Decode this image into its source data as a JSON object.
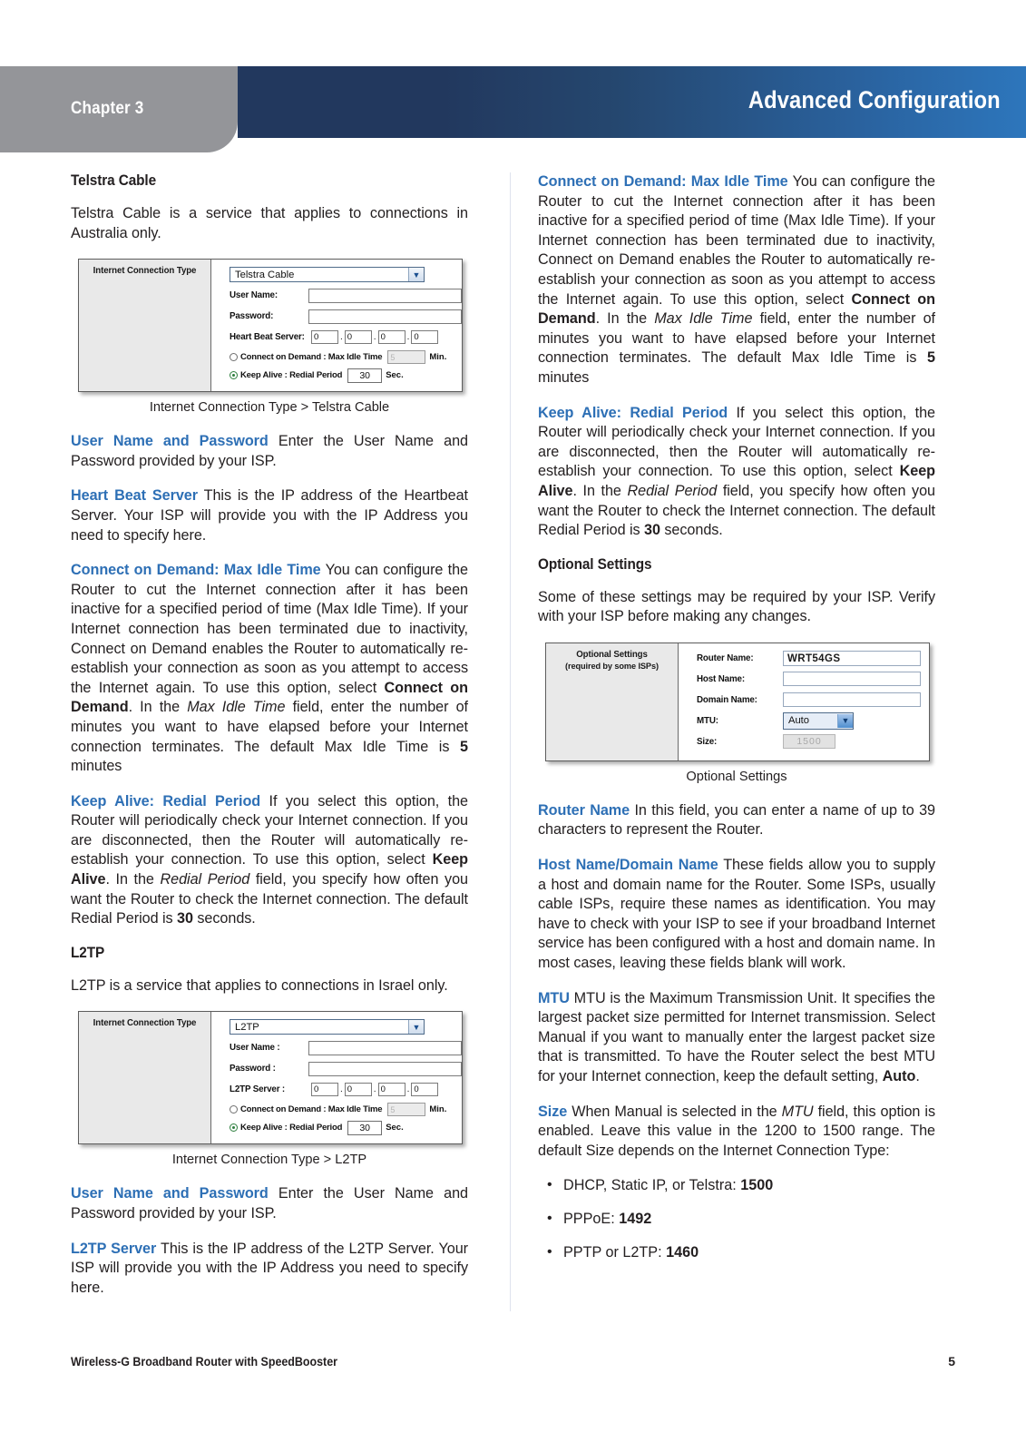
{
  "header": {
    "chapter": "Chapter 3",
    "title": "Advanced Configuration",
    "tab_color": "#949599",
    "bar_color_left": "#22385e",
    "bar_color_right": "#2d76bc"
  },
  "accent_color": "#2d6fb5",
  "left_column": {
    "telstra_heading": "Telstra Cable",
    "telstra_intro": "Telstra Cable is a service that applies to connections in Australia only.",
    "telstra_figure": {
      "panel_title": "Internet Connection Type",
      "select_value": "Telstra Cable",
      "rows": [
        {
          "label": "User Name:",
          "value": ""
        },
        {
          "label": "Password:",
          "value": ""
        }
      ],
      "ip_label": "Heart Beat Server:",
      "ip_octets": [
        "0",
        "0",
        "0",
        "0"
      ],
      "connect_on_demand_label": "Connect on Demand : Max Idle Time",
      "connect_on_demand_value": "5",
      "connect_on_demand_unit": "Min.",
      "connect_on_demand_selected": false,
      "keep_alive_label": "Keep Alive : Redial Period",
      "keep_alive_value": "30",
      "keep_alive_unit": "Sec.",
      "keep_alive_selected": true,
      "caption": "Internet Connection Type > Telstra Cable"
    },
    "user_name_password_term": "User Name and Password",
    "user_name_password_text": " Enter the User Name and Password provided by your ISP.",
    "heart_beat_term": "Heart Beat Server",
    "heart_beat_text": "  This is the IP address of the  Heartbeat Server. Your ISP will provide you with the IP Address you need to specify here.",
    "cod_term": "Connect on Demand: Max Idle Time",
    "cod_text_1": "  You can configure the Router to cut the Internet connection after it has been inactive for a specified period of time (Max Idle Time). If your Internet connection has been terminated due to inactivity, Connect on Demand enables the Router to automatically re-establish your connection as soon as you attempt to access the Internet again. To use this option, select ",
    "cod_bold_1": "Connect on Demand",
    "cod_text_2": ". In the ",
    "cod_italic": "Max Idle Time",
    "cod_text_3": " field, enter the number of minutes you want to have elapsed before your Internet connection terminates. The default Max Idle Time is ",
    "cod_bold_2": "5",
    "cod_text_4": " minutes",
    "ka_term": "Keep Alive: Redial Period",
    "ka_text_1": " If you select this option, the Router will periodically check your Internet connection. If you are disconnected, then the Router will automatically re-establish your connection. To use this option, select ",
    "ka_bold_1": "Keep Alive",
    "ka_text_2": ". In the ",
    "ka_italic": "Redial Period",
    "ka_text_3": " field, you specify how often you want the Router to check the Internet connection. The default Redial Period is ",
    "ka_bold_2": "30",
    "ka_text_4": " seconds.",
    "l2tp_heading": "L2TP",
    "l2tp_intro": "L2TP is a service that applies to connections in Israel only.",
    "l2tp_figure": {
      "panel_title": "Internet Connection Type",
      "select_value": "L2TP",
      "rows": [
        {
          "label": "User Name :",
          "value": ""
        },
        {
          "label": "Password :",
          "value": ""
        }
      ],
      "ip_label": "L2TP Server :",
      "ip_octets": [
        "0",
        "0",
        "0",
        "0"
      ],
      "connect_on_demand_label": "Connect on Demand : Max Idle Time",
      "connect_on_demand_value": "5",
      "connect_on_demand_unit": "Min.",
      "connect_on_demand_selected": false,
      "keep_alive_label": "Keep Alive : Redial Period",
      "keep_alive_value": "30",
      "keep_alive_unit": "Sec.",
      "keep_alive_selected": true,
      "caption": "Internet Connection Type > L2TP"
    },
    "l2tp_unp_term": "User Name and Password",
    "l2tp_unp_text": " Enter the User Name and Password provided by your ISP.",
    "l2tp_server_term": "L2TP Server",
    "l2tp_server_text": "  This is the IP address of the L2TP Server. Your ISP will provide you with the IP Address you need to specify here."
  },
  "right_column": {
    "cod_term": "Connect on Demand: Max Idle Time",
    "cod_text_1": "  You can configure the Router to cut the Internet connection after it has been inactive for a specified period of time (Max Idle Time). If your Internet connection has been terminated due to inactivity, Connect on Demand enables the Router to automatically re-establish your connection as soon as you attempt to access the Internet again. To use this option, select ",
    "cod_bold_1": "Connect on Demand",
    "cod_text_2": ". In the ",
    "cod_italic": "Max Idle Time",
    "cod_text_3": " field, enter the number of minutes you want to have elapsed before your Internet connection terminates. The default Max Idle Time is ",
    "cod_bold_2": "5",
    "cod_text_4": " minutes",
    "ka_term": "Keep Alive: Redial Period",
    "ka_text_1": " If you select this option, the Router will periodically check your Internet connection. If you are disconnected, then the Router will automatically re-establish your connection. To use this option, select ",
    "ka_bold_1": "Keep Alive",
    "ka_text_2": ". In the ",
    "ka_italic": "Redial Period",
    "ka_text_3": " field, you specify how often you want the Router to check the Internet connection. The default Redial Period is ",
    "ka_bold_2": "30",
    "ka_text_4": " seconds.",
    "optional_heading": "Optional Settings",
    "optional_intro": "Some of these settings may be required by your ISP. Verify with your ISP before making any changes.",
    "optional_figure": {
      "panel_title_line1": "Optional Settings",
      "panel_title_line2": "(required by some ISPs)",
      "rows": [
        {
          "label": "Router Name:",
          "value": "WRT54GS"
        },
        {
          "label": "Host Name:",
          "value": ""
        },
        {
          "label": "Domain Name:",
          "value": ""
        }
      ],
      "mtu_label": "MTU:",
      "mtu_value": "Auto",
      "size_label": "Size:",
      "size_value": "1500",
      "caption": "Optional Settings"
    },
    "router_name_term": "Router Name",
    "router_name_text": "  In this field, you can enter a name of up to 39 characters to represent the Router.",
    "host_domain_term": "Host Name/Domain Name",
    "host_domain_text": " These fields allow you to supply a host and domain name for the Router. Some ISPs, usually cable ISPs, require these names as identification. You may have to check with your ISP to see if your broadband Internet service has been configured with a host and domain name. In most cases, leaving these fields blank will work.",
    "mtu_term": "MTU",
    "mtu_text_1": "  MTU is the Maximum Transmission Unit. It specifies the largest packet size permitted for Internet transmission. Select Manual if you want to manually enter the largest packet size that is transmitted. To have the Router select the best MTU for your Internet connection, keep the default setting, ",
    "mtu_bold": "Auto",
    "mtu_text_2": ".",
    "size_term": "Size",
    "size_text_1": "  When Manual is selected in the ",
    "size_italic": "MTU",
    "size_text_2": " field, this option is enabled. Leave this value in the 1200 to 1500 range. The default Size depends on the Internet Connection Type:",
    "size_bullets": [
      {
        "text": "DHCP, Static IP, or Telstra: ",
        "value": "1500"
      },
      {
        "text": "PPPoE: ",
        "value": "1492"
      },
      {
        "text": "PPTP or L2TP: ",
        "value": "1460"
      }
    ]
  },
  "footer": {
    "product": "Wireless-G Broadband Router with SpeedBooster",
    "page_number": "5"
  }
}
